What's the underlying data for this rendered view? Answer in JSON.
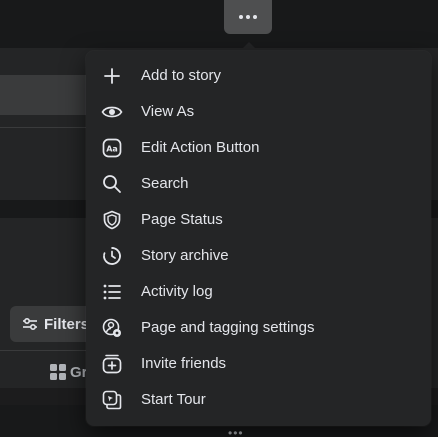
{
  "menu": {
    "items": [
      {
        "label": "Add to story",
        "icon": "plus-icon"
      },
      {
        "label": "View As",
        "icon": "eye-icon"
      },
      {
        "label": "Edit Action Button",
        "icon": "action-button-icon"
      },
      {
        "label": "Search",
        "icon": "search-icon"
      },
      {
        "label": "Page Status",
        "icon": "shield-icon"
      },
      {
        "label": "Story archive",
        "icon": "clock-archive-icon"
      },
      {
        "label": "Activity log",
        "icon": "list-icon"
      },
      {
        "label": "Page and tagging settings",
        "icon": "person-gear-icon"
      },
      {
        "label": "Invite friends",
        "icon": "invite-icon"
      },
      {
        "label": "Start Tour",
        "icon": "tour-icon"
      }
    ]
  },
  "background": {
    "filters_label": "Filters",
    "grid_tab_label": "Gr"
  },
  "colors": {
    "page_bg": "#18191a",
    "card_bg": "#242526",
    "text": "#e4e6eb",
    "button_bg": "#3a3b3c",
    "more_button_bg": "#4e4f50"
  }
}
